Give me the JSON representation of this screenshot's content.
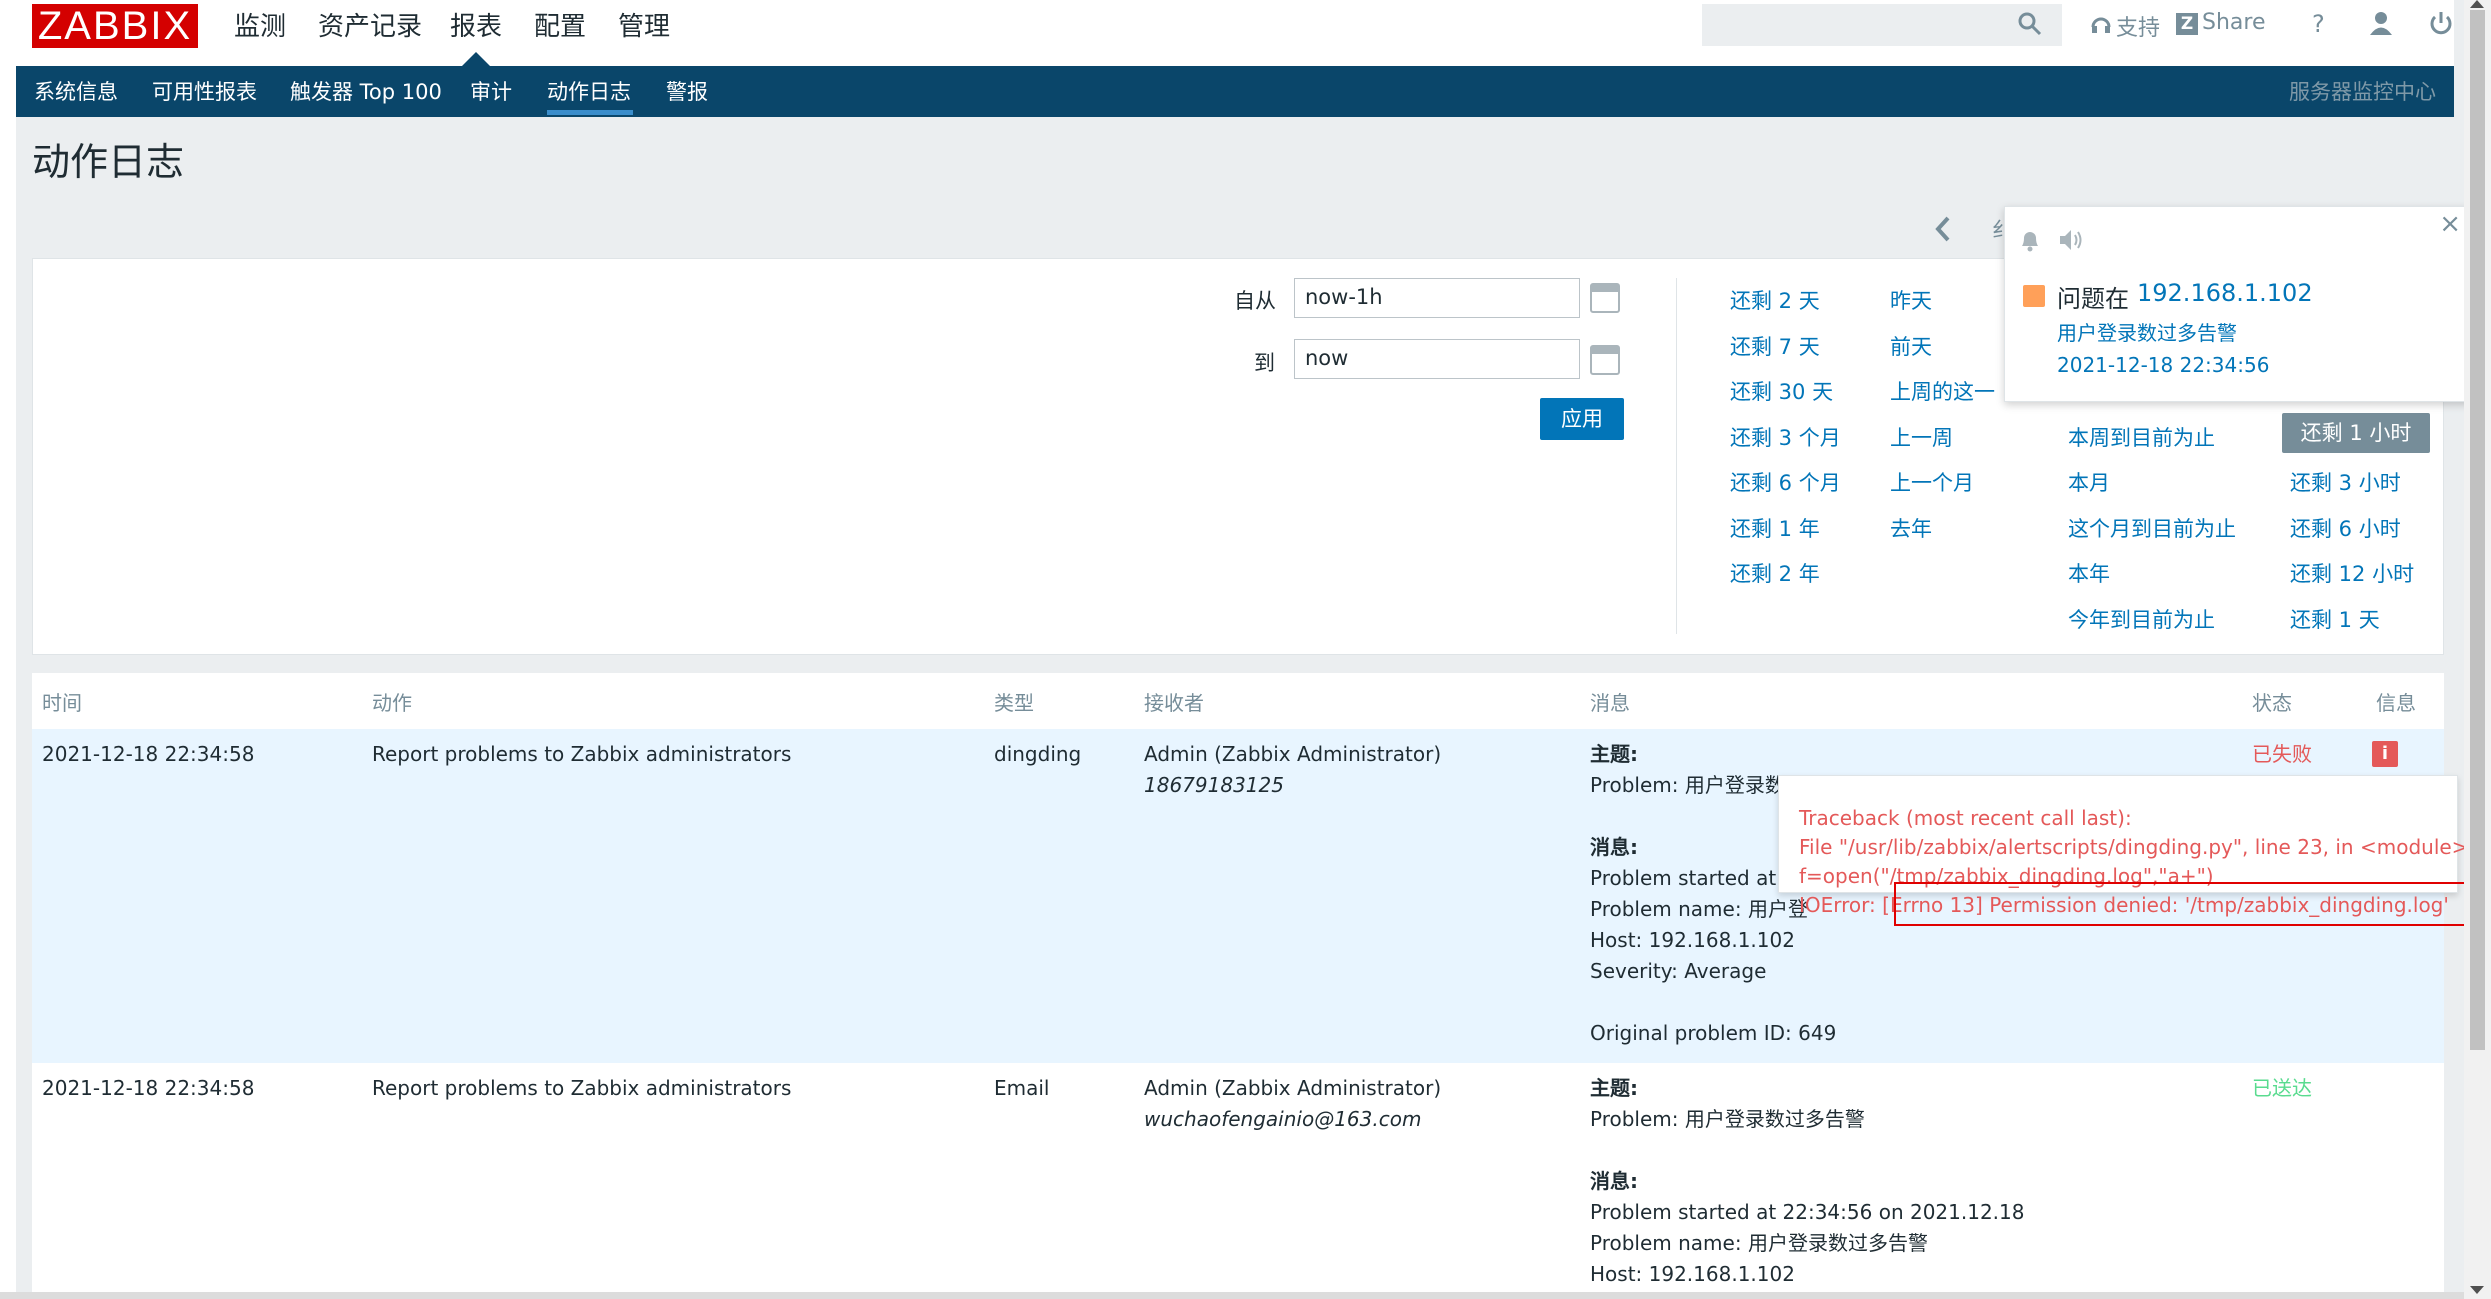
{
  "brand": {
    "logo": "ZABBIX",
    "color": "#d40000"
  },
  "main_menu": [
    "监测",
    "资产记录",
    "报表",
    "配置",
    "管理"
  ],
  "top_links": {
    "support": "支持",
    "share": "Share",
    "help": "?"
  },
  "sub_menu": [
    "系统信息",
    "可用性报表",
    "触发器 Top 100",
    "审计",
    "动作日志",
    "警报"
  ],
  "server_name": "服务器监控中心",
  "page_title": "动作日志",
  "filter": {
    "tab_partial": "纟",
    "from_label": "自从",
    "from_value": "now-1h",
    "to_label": "到",
    "to_value": "now",
    "apply": "应用"
  },
  "quick_ranges": {
    "col1": [
      "还剩 2 天",
      "还剩 7 天",
      "还剩 30 天",
      "还剩 3 个月",
      "还剩 6 个月",
      "还剩 1 年",
      "还剩 2 年"
    ],
    "col2": [
      "昨天",
      "前天",
      "上周的这一",
      "上一周",
      "上一个月",
      "去年"
    ],
    "col3": [
      "本周到目前为止",
      "本月",
      "这个月到目前为止",
      "本年",
      "今年到目前为止"
    ],
    "col4": [
      "还剩 1 小时",
      "还剩 3 小时",
      "还剩 6 小时",
      "还剩 12 小时",
      "还剩 1 天"
    ]
  },
  "table": {
    "headers": [
      "时间",
      "动作",
      "类型",
      "接收者",
      "消息",
      "状态",
      "信息"
    ],
    "rows": [
      {
        "time": "2021-12-18 22:34:58",
        "action": "Report problems to Zabbix administrators",
        "type": "dingding",
        "recipient": "Admin (Zabbix Administrator)",
        "recipient_addr": "18679183125",
        "subject_label": "主题:",
        "subject": "Problem: 用户登录数过",
        "message_label": "消息:",
        "lines": [
          "Problem started at 22:3",
          "Problem name: 用户登",
          "Host: 192.168.1.102",
          "Severity: Average",
          "",
          "Original problem ID: 649"
        ],
        "status": "已失败",
        "info": "i"
      },
      {
        "time": "2021-12-18 22:34:58",
        "action": "Report problems to Zabbix administrators",
        "type": "Email",
        "recipient": "Admin (Zabbix Administrator)",
        "recipient_addr": "wuchaofengainio@163.com",
        "subject_label": "主题:",
        "subject": "Problem: 用户登录数过多告警",
        "message_label": "消息:",
        "lines": [
          "Problem started at 22:34:56 on 2021.12.18",
          "Problem name: 用户登录数过多告警",
          "Host: 192.168.1.102"
        ],
        "status": "已送达"
      }
    ]
  },
  "error_tooltip": [
    "Traceback (most recent call last):",
    "File \"/usr/lib/zabbix/alertscripts/dingding.py\", line 23, in <module>",
    "f=open(\"/tmp/zabbix_dingding.log\",\"a+\")",
    "IOError: [Errno 13] Permission denied: '/tmp/zabbix_dingding.log'"
  ],
  "notification": {
    "title_prefix": "问题在",
    "host": "192.168.1.102",
    "problem": "用户登录数过多告警",
    "time": "2021-12-18 22:34:56",
    "close": "×"
  },
  "colors": {
    "nav": "#0a466a",
    "link": "#0275b8",
    "fail": "#e45959",
    "ok": "#59db8f",
    "row_highlight": "#e8f5ff"
  }
}
